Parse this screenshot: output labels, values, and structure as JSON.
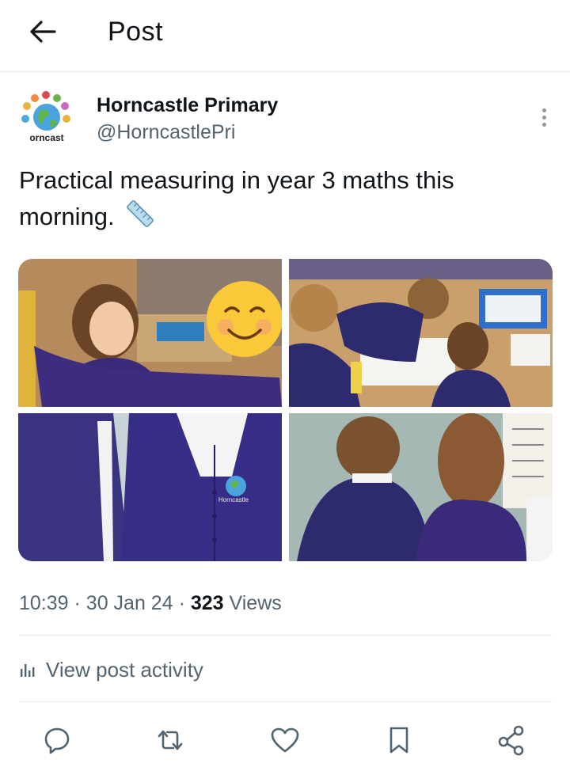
{
  "header": {
    "title": "Post",
    "back_icon": "arrow-left-icon"
  },
  "author": {
    "display_name": "Horncastle Primary",
    "handle": "@HorncastlePri",
    "avatar_text": "orncast",
    "more_icon": "more-vertical-icon"
  },
  "post": {
    "text": "Practical measuring in year 3 maths this morning.",
    "emoji_icon": "straight-ruler-icon",
    "images": [
      {
        "name": "children-measuring-with-ruler-photo",
        "emoji_icon": "smiling-face-emoji"
      },
      {
        "name": "children-working-at-table-photo"
      },
      {
        "name": "children-in-uniform-cardigans-photo",
        "badge_text": "Horncastle"
      },
      {
        "name": "children-reading-display-board-photo"
      }
    ]
  },
  "meta": {
    "time": "10:39",
    "separator": "·",
    "date": "30 Jan 24",
    "views_count": "323",
    "views_label": "Views"
  },
  "activity": {
    "label": "View post activity",
    "icon": "bar-chart-icon"
  },
  "actions": [
    {
      "name": "reply-button",
      "icon": "speech-bubble-icon"
    },
    {
      "name": "repost-button",
      "icon": "repost-arrows-icon"
    },
    {
      "name": "like-button",
      "icon": "heart-icon"
    },
    {
      "name": "bookmark-button",
      "icon": "bookmark-icon"
    },
    {
      "name": "share-button",
      "icon": "share-nodes-icon"
    }
  ],
  "colors": {
    "text_primary": "#0f1419",
    "text_secondary": "#536471",
    "divider": "#e6ecf0",
    "uniform_purple": "#3b2a7a"
  }
}
